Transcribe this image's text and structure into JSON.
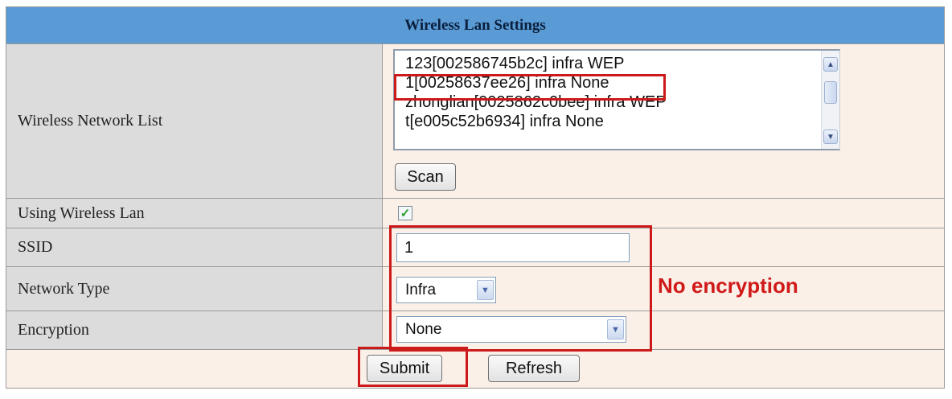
{
  "title": "Wireless Lan Settings",
  "network_list": {
    "label": "Wireless Network List",
    "items": [
      "123[002586745b2c] infra WEP",
      "1[00258637ee26] infra None",
      "zhonglian[0025862c0bee] infra WEP",
      "t[e005c52b6934] infra None"
    ],
    "highlighted_index": 1,
    "scan_label": "Scan"
  },
  "using_wireless": {
    "label": "Using Wireless Lan",
    "checked": true
  },
  "ssid": {
    "label": "SSID",
    "value": "1"
  },
  "network_type": {
    "label": "Network Type",
    "value": "Infra"
  },
  "encryption": {
    "label": "Encryption",
    "value": "None"
  },
  "annotation": "No encryption",
  "buttons": {
    "submit": "Submit",
    "refresh": "Refresh"
  },
  "colors": {
    "header": "#5b9bd5",
    "annotation": "#d01a1a",
    "label_cell": "#dcdcdc",
    "value_cell": "#fbf0e8"
  }
}
